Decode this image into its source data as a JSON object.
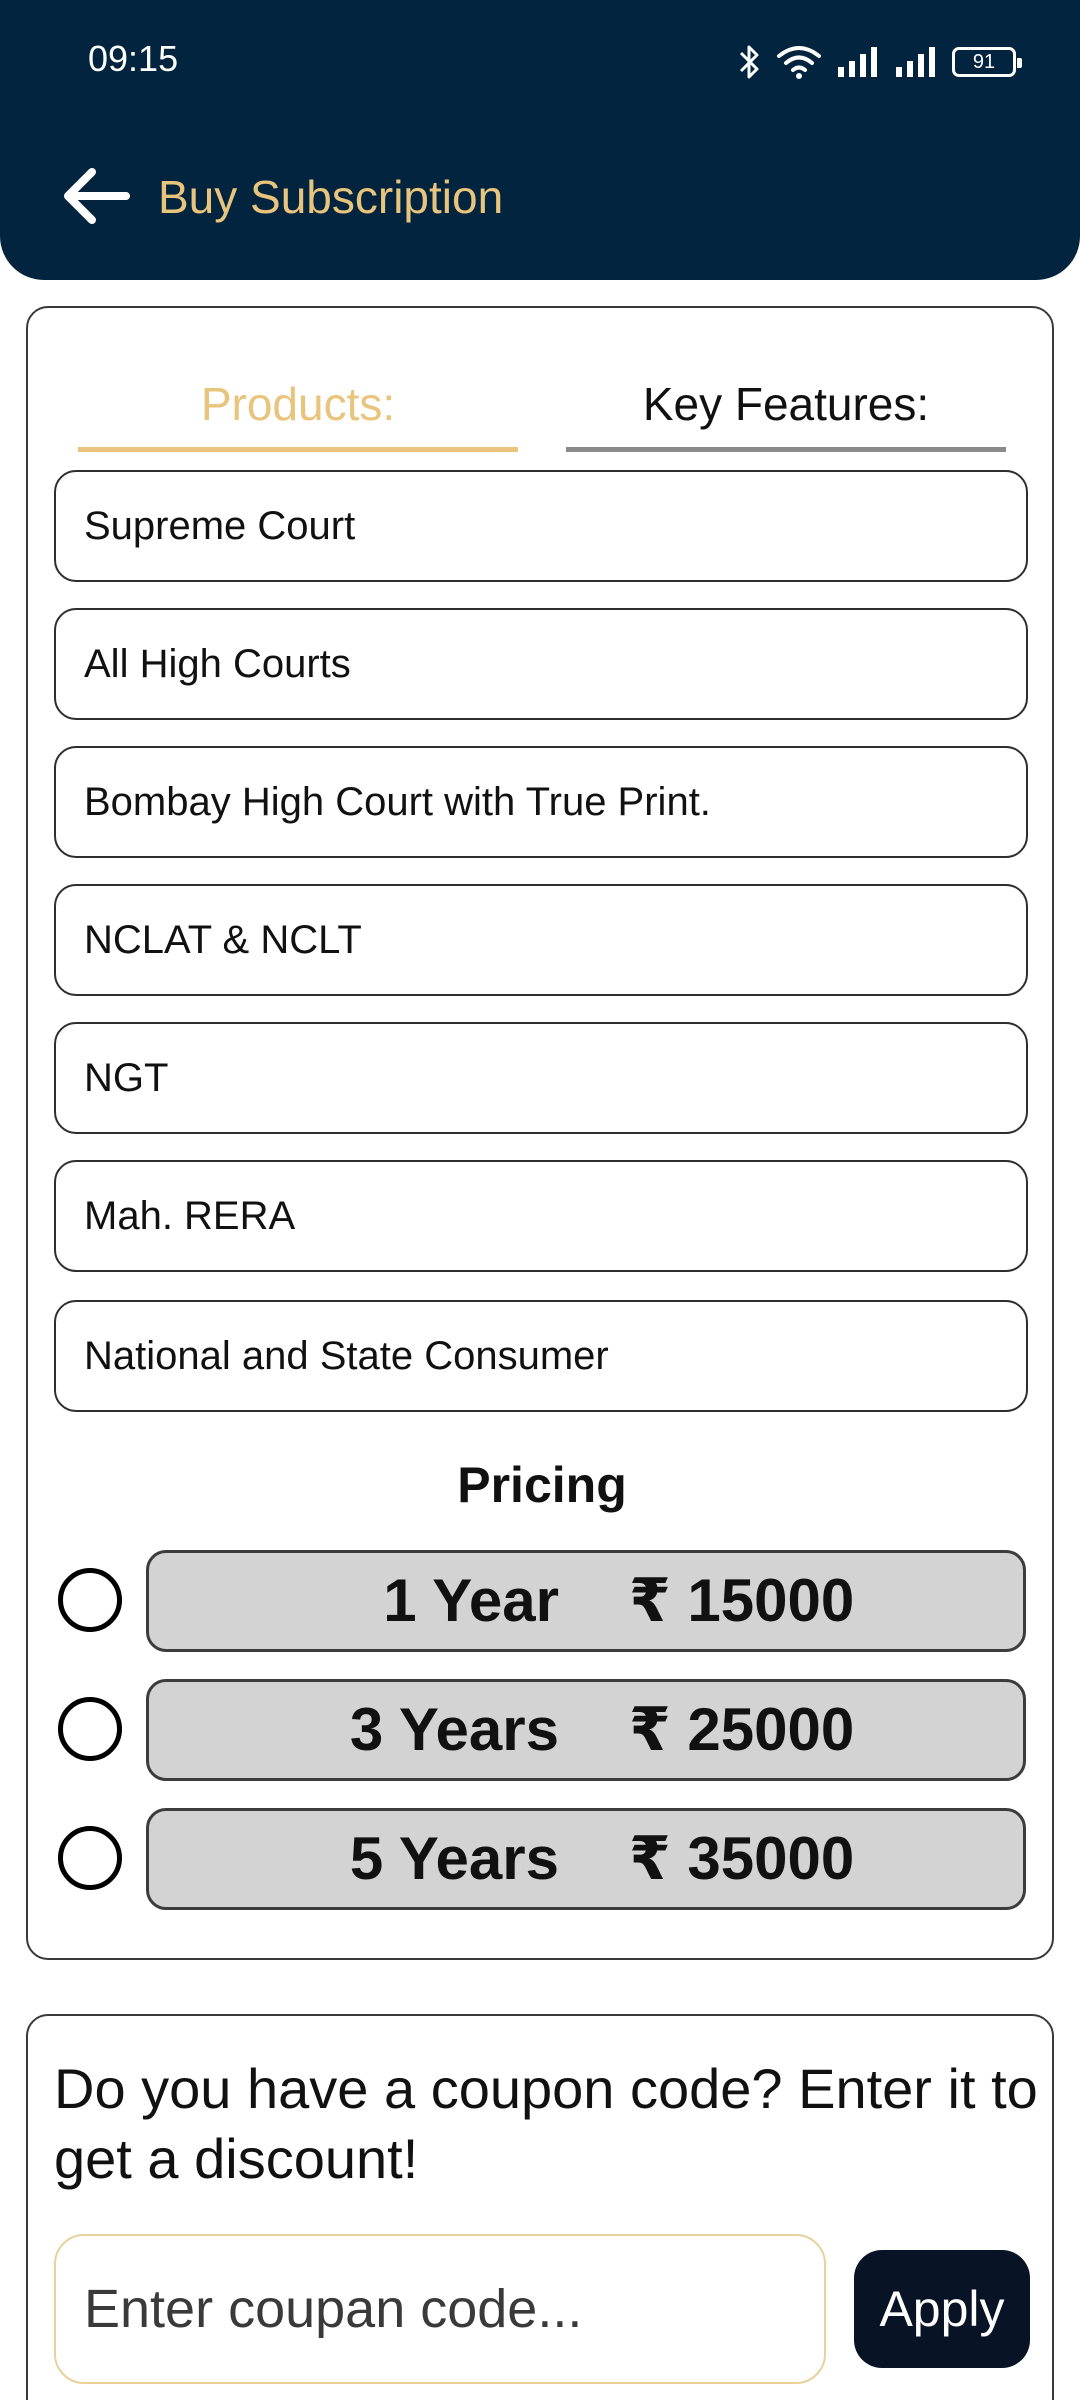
{
  "status_bar": {
    "time": "09:15",
    "battery": "91"
  },
  "header": {
    "title": "Buy Subscription"
  },
  "tabs": [
    {
      "label": "Products:",
      "active": true
    },
    {
      "label": "Key Features:",
      "active": false
    }
  ],
  "products": [
    "Supreme Court",
    "All High Courts",
    "Bombay High Court with True Print.",
    "NCLAT & NCLT",
    "NGT",
    "Mah. RERA",
    "National and State Consumer"
  ],
  "pricing": {
    "title": "Pricing",
    "plans": [
      {
        "duration": "1 Year",
        "price": "₹ 15000",
        "selected": false
      },
      {
        "duration": "3 Years",
        "price": "₹ 25000",
        "selected": false
      },
      {
        "duration": "5 Years",
        "price": "₹ 35000",
        "selected": false
      }
    ]
  },
  "coupon": {
    "prompt": "Do you have a coupon code? Enter it to get a discount!",
    "placeholder": "Enter coupan code...",
    "apply_label": "Apply"
  },
  "colors": {
    "header_bg": "#03243e",
    "accent": "#e8c47c",
    "button_bg": "#081425",
    "price_bg": "#d3d3d3"
  }
}
